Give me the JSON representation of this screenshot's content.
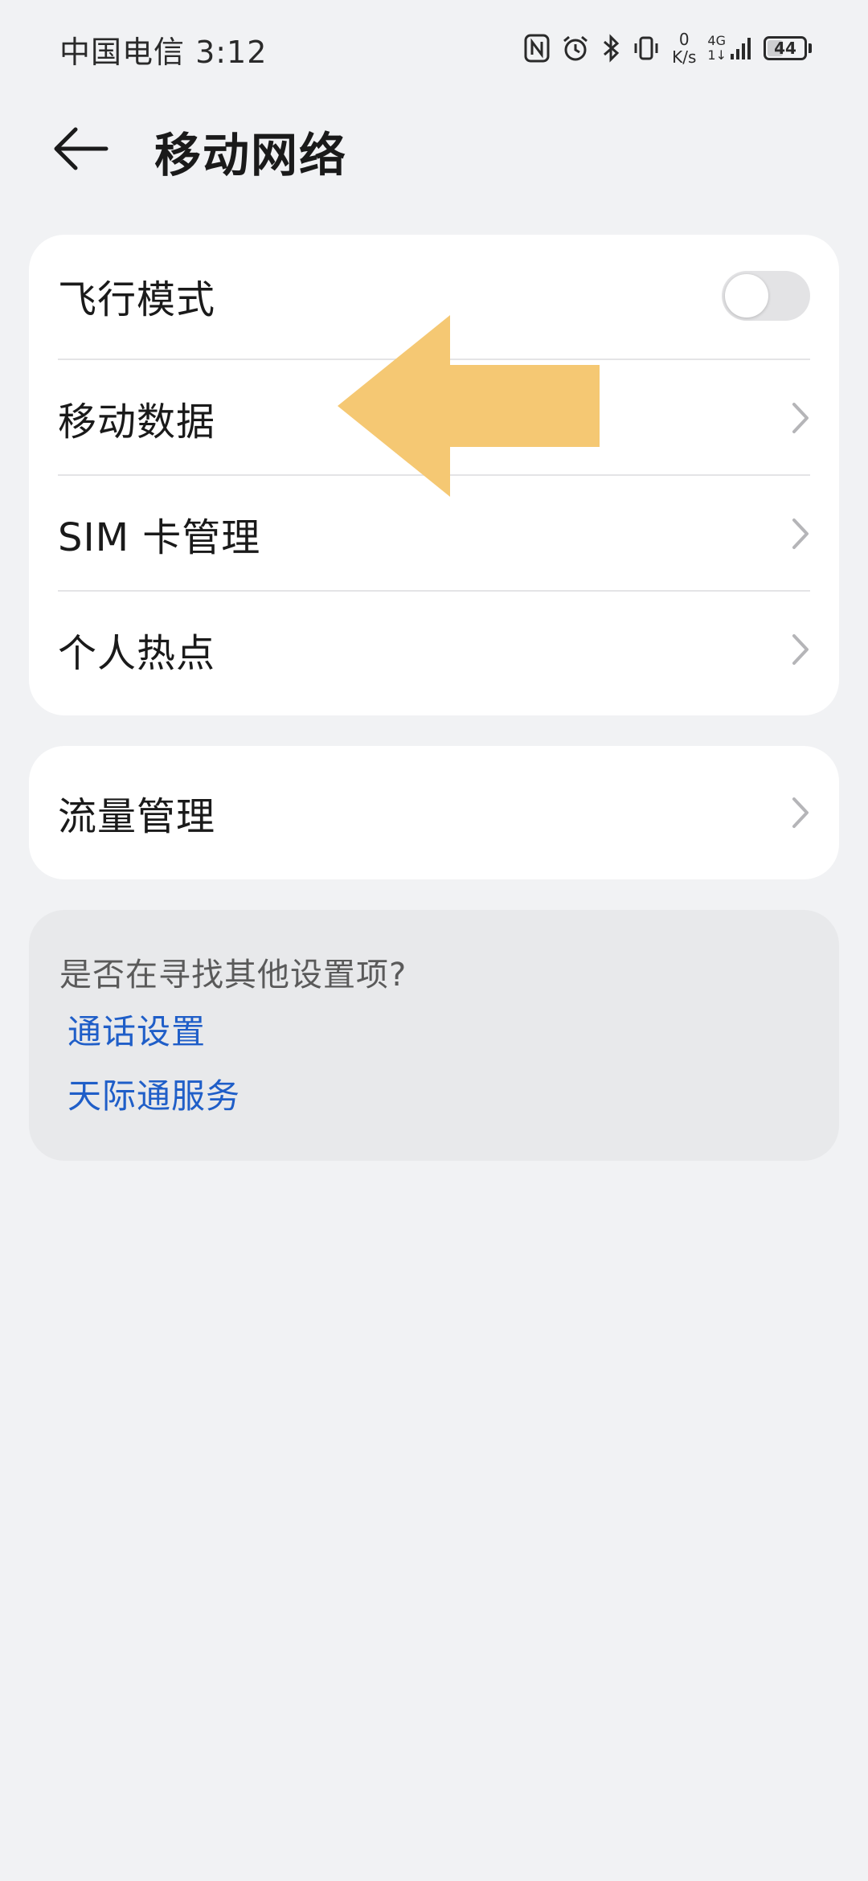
{
  "status_bar": {
    "carrier_time": "中国电信 3:12",
    "net_speed_value": "0",
    "net_speed_unit": "K/s",
    "signal_label_top": "4G",
    "signal_label_bottom": "1↓",
    "battery_level": "44",
    "battery_fraction": 0.44,
    "icons": [
      "nfc-icon",
      "alarm-icon",
      "bluetooth-icon",
      "vibrate-icon",
      "signal-icon",
      "battery-icon"
    ]
  },
  "header": {
    "back_icon": "arrow-left-icon",
    "title": "移动网络"
  },
  "settings": {
    "group_1": [
      {
        "label": "飞行模式",
        "control": "toggle",
        "value": false
      },
      {
        "label": "移动数据",
        "control": "chevron"
      },
      {
        "label": "SIM 卡管理",
        "control": "chevron"
      },
      {
        "label": "个人热点",
        "control": "chevron"
      }
    ],
    "group_2": [
      {
        "label": "流量管理",
        "control": "chevron"
      }
    ]
  },
  "suggestions": {
    "title": "是否在寻找其他设置项?",
    "links": [
      "通话设置",
      "天际通服务"
    ]
  },
  "colors": {
    "background": "#f1f2f4",
    "card": "#ffffff",
    "suggestion_card": "#e8e9eb",
    "link": "#1f5ec8",
    "annotation_arrow": "#f5c873"
  }
}
